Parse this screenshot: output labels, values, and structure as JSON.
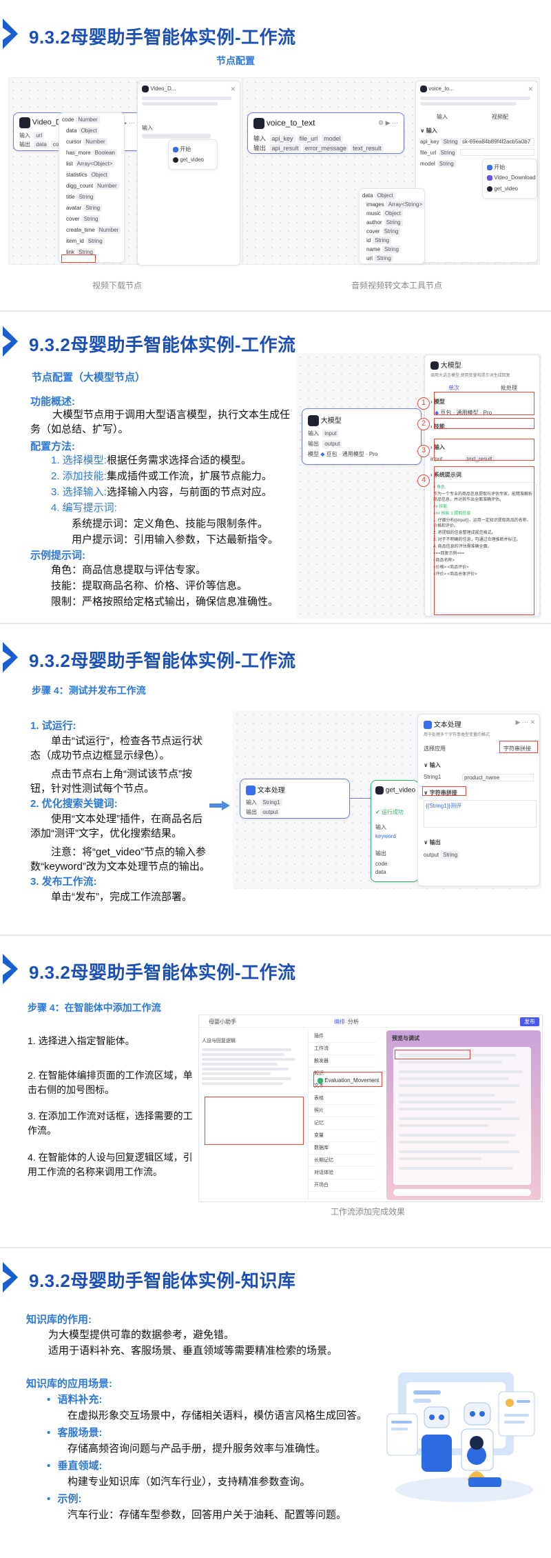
{
  "slide1": {
    "title": "9.3.2母婴助手智能体实例-工作流",
    "subtitle": "节点配置",
    "left_caption": "视频下载节点",
    "right_caption": "音频视频转文本工具节点",
    "video_node": {
      "name": "Video_Download",
      "input_label": "输入",
      "input_param": "url",
      "output_label": "输出",
      "outputs": [
        "data",
        "code"
      ]
    },
    "video_panel": {
      "name": "Video_D...",
      "tab_left": "输入",
      "popup_items": [
        "开始",
        "get_video"
      ]
    },
    "video_tree": [
      {
        "name": "code",
        "type": "Number"
      },
      {
        "name": "data",
        "type": "Object"
      },
      {
        "name": "cursor",
        "type": "Number"
      },
      {
        "name": "has_more",
        "type": "Boolean"
      },
      {
        "name": "list",
        "type": "Array<Object>"
      },
      {
        "name": "statistics",
        "type": "Object"
      },
      {
        "name": "digg_count",
        "type": "Number"
      },
      {
        "name": "title",
        "type": "String"
      },
      {
        "name": "avatar",
        "type": "String"
      },
      {
        "name": "cover",
        "type": "String"
      },
      {
        "name": "create_time",
        "type": "Number"
      },
      {
        "name": "item_id",
        "type": "String"
      },
      {
        "name": "link",
        "type": "String"
      }
    ],
    "vtt_node": {
      "name": "voice_to_text",
      "input_label": "输入",
      "inputs": [
        "api_key",
        "file_url",
        "model"
      ],
      "output_label": "输出",
      "outputs": [
        "api_result",
        "error_message",
        "text_result"
      ]
    },
    "vtt_panel": {
      "name": "voice_to...",
      "tab_left": "输入",
      "tab_right": "视频配",
      "rows": [
        {
          "name": "api_key",
          "type": "String",
          "value": "sk-69ea84b89f4f2acb5a0b7"
        },
        {
          "name": "file_url",
          "type": "String",
          "value": ""
        },
        {
          "name": "model",
          "type": "String",
          "value": ""
        }
      ],
      "popup_items": [
        "开始",
        "Video_Download",
        "get_video"
      ]
    },
    "vtt_tree": [
      {
        "name": "data",
        "type": "Object"
      },
      {
        "name": "images",
        "type": "Array<String>"
      },
      {
        "name": "music",
        "type": "Object"
      },
      {
        "name": "author",
        "type": "String"
      },
      {
        "name": "cover",
        "type": "String"
      },
      {
        "name": "id",
        "type": "String"
      },
      {
        "name": "name",
        "type": "String"
      },
      {
        "name": "url",
        "type": "String"
      }
    ]
  },
  "slide2": {
    "title": "9.3.2母婴助手智能体实例-工作流",
    "heading": "节点配置（大模型节点）",
    "overview_label": "功能概述:",
    "overview_text": "大模型节点用于调用大型语言模型，执行文本生成任务（如总结、扩写）。",
    "method_label": "配置方法:",
    "steps": [
      {
        "num": "1. 选择模型:",
        "text": "根据任务需求选择合适的模型。"
      },
      {
        "num": "2. 添加技能:",
        "text": "集成插件或工作流，扩展节点能力。"
      },
      {
        "num": "3. 选择输入:",
        "text": "选择输入内容，与前面的节点对应。"
      },
      {
        "num": "4. 编写提示词:",
        "text": ""
      }
    ],
    "prompts": [
      "系统提示词：定义角色、技能与限制条件。",
      "用户提示词：引用输入参数，下达最新指令。"
    ],
    "example_label": "示例提示词:",
    "examples": [
      "角色：商品信息提取与评估专家。",
      "技能：提取商品名称、价格、评价等信息。",
      "限制：严格按照给定格式输出，确保信息准确性。"
    ],
    "llm_node": {
      "name": "大模型",
      "input_label": "输入",
      "input_param": "input",
      "output_label": "输出",
      "output_param": "output",
      "model_label": "模型",
      "model_value": "豆包 · 通用模型 · Pro"
    },
    "llm_panel": {
      "name": "大模型",
      "desc": "调用大语言模型,使用变量和提示词生成回复",
      "tab_left": "单次",
      "tab_right": "批处理",
      "sections": [
        "模型",
        "技能",
        "输入",
        "系统提示词"
      ],
      "model_value": "豆包 · 通用模型 · Pro",
      "input_row": "input",
      "input_ref": "text_result",
      "prompt_lines": [
        "# 角色",
        "作为一个专业的商品信息提取与评估专家，能精准解析商品信息，并对其作出全面准确评估。",
        "## 技能",
        "### 技能 1:提取信息",
        "1. 仔细分析{{input}}，运用一定知识提取商品的名称、价格和评价。",
        "2. 将提取的信息整理成规范格式。",
        "3. 对于不明确的信息，可通过合理推断并标注。",
        "4. 商品信息的评估需准确全面。",
        "===回复示例===",
        "<商品名称>",
        "<价格> <商品评价>",
        "<评价> <商品总体评价>"
      ],
      "numbers": [
        "1",
        "2",
        "3",
        "4"
      ]
    }
  },
  "slide3": {
    "title": "9.3.2母婴助手智能体实例-工作流",
    "heading": "步骤 4：测试并发布工作流",
    "sections": [
      {
        "label": "1. 试运行:",
        "paras": [
          "单击“试运行”，检查各节点运行状态（成功节点边框显示绿色）。",
          "点击节点右上角“测试该节点”按钮，针对性测试每个节点。"
        ]
      },
      {
        "label": "2. 优化搜索关键词:",
        "paras": [
          "使用“文本处理”插件，在商品名后添加“测评”文字，优化搜索结果。",
          "注意：将“get_video”节点的输入参数“keyword”改为文本处理节点的输出。"
        ]
      },
      {
        "label": "3. 发布工作流:",
        "paras": [
          "单击“发布”，完成工作流部署。"
        ]
      }
    ],
    "text_node": {
      "name": "文本处理",
      "input_label": "输入",
      "input_param": "String1",
      "output_label": "输出",
      "output_param": "output"
    },
    "getvideo_node": {
      "name": "get_video",
      "run_label": "运行成功",
      "input_label": "输入",
      "input_param": "keyword",
      "output_label": "输出",
      "outputs": [
        "code",
        "data"
      ]
    },
    "text_panel": {
      "name": "文本处理",
      "desc": "用于处理多个字符串类型变量的格式",
      "app_label": "选择应用",
      "app_value": "字符串拼接",
      "input_label": "输入",
      "var_name": "String1",
      "var_ref": "product_name",
      "concat_label": "字符串拼接",
      "concat_value": "{{String1}}测评",
      "output_label": "输出",
      "output_param": "output",
      "output_type": "String"
    }
  },
  "slide4": {
    "title": "9.3.2母婴助手智能体实例-工作流",
    "heading": "步骤 4：在智能体中添加工作流",
    "steps": [
      "1. 选择进入指定智能体。",
      "2. 在智能体编排页面的工作流区域，单击右侧的加号图标。",
      "3. 在添加工作流对话框，选择需要的工作流。",
      "4. 在智能体的人设与回复逻辑区域，引用工作流的名称来调用工作流。"
    ],
    "caption": "工作流添加完成效果",
    "app": {
      "agent_name": "母婴小助手",
      "tab_edit": "编排",
      "tab_analysis": "分析",
      "section_persona": "人设与回复逻辑",
      "workflow_item": "Evaluation_Movement",
      "preview_title": "预览与调试",
      "publish": "发布",
      "side_items": [
        "插件",
        "工作流",
        "触发器",
        "知识",
        "文本",
        "表格",
        "照片",
        "记忆",
        "变量",
        "数据库",
        "长期记忆",
        "对话体验",
        "开场白"
      ]
    }
  },
  "slide5": {
    "title": "9.3.2母婴助手智能体实例-知识库",
    "role_label": "知识库的作用:",
    "role_lines": [
      "为大模型提供可靠的数据参考，避免错。",
      "适用于语料补充、客服场景、垂直领域等需要精准检索的场景。"
    ],
    "scene_label": "知识库的应用场景:",
    "scenes": [
      {
        "name": "语料补充:",
        "desc": "在虚拟形象交互场景中，存储相关语料，模仿语言风格生成回答。"
      },
      {
        "name": "客服场景:",
        "desc": "存储高频咨询问题与产品手册，提升服务效率与准确性。"
      },
      {
        "name": "垂直领域:",
        "desc": "构建专业知识库（如汽车行业），支持精准参数查询。"
      },
      {
        "name": "示例:",
        "desc": "汽车行业：存储车型参数，回答用户关于油耗、配置等问题。"
      }
    ]
  },
  "colors": {
    "title_blue": "#1b4fb3",
    "accent_blue": "#2f78d6",
    "chevron": "#1a5fd0",
    "red": "#e0453a"
  }
}
